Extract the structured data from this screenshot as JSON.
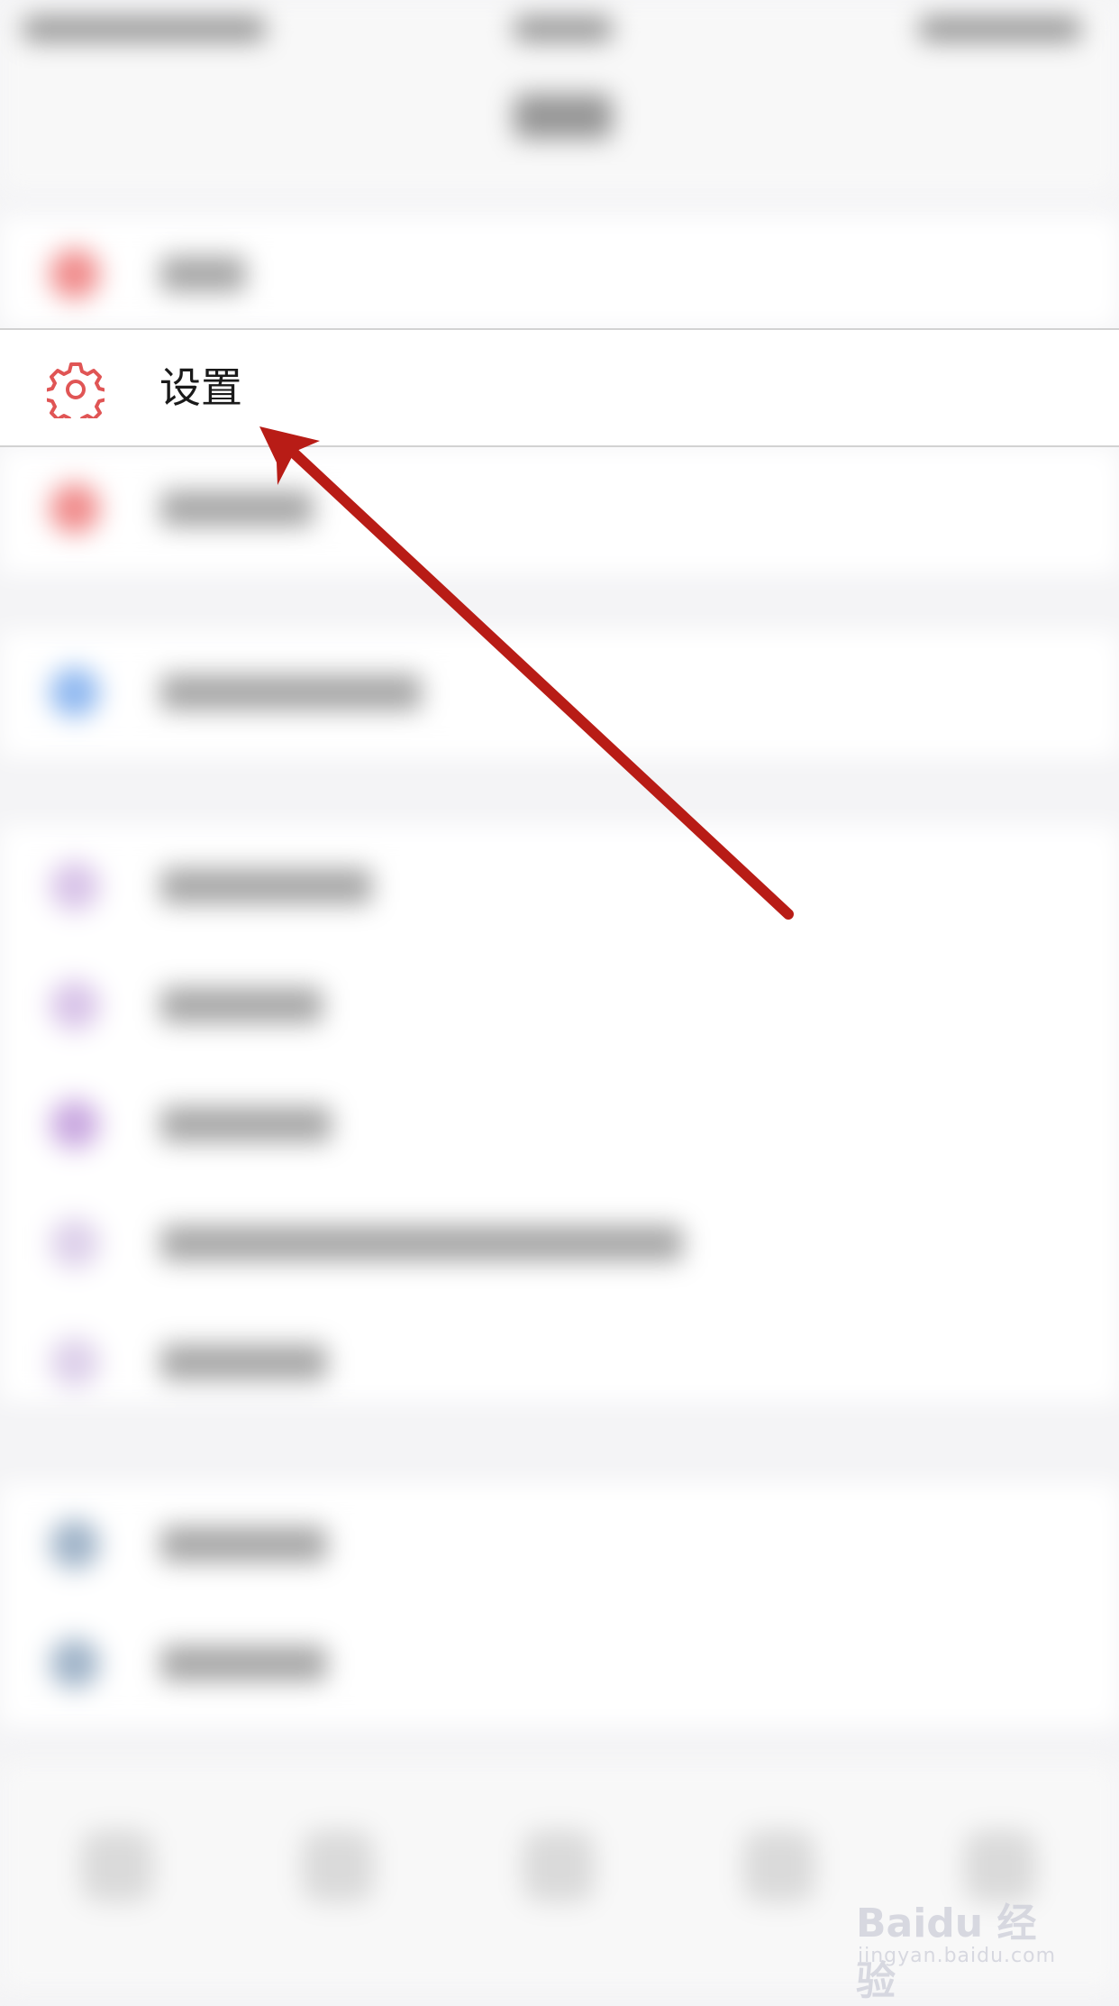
{
  "settings_item": {
    "label": "设置"
  },
  "colors": {
    "accent": "#e05555",
    "arrow": "#b81c16"
  },
  "icons": {
    "settings": "gear-icon",
    "arrow": "pointer-arrow"
  },
  "watermark": {
    "brand": "Baidu",
    "service": "经验",
    "url": "jingyan.baidu.com"
  }
}
